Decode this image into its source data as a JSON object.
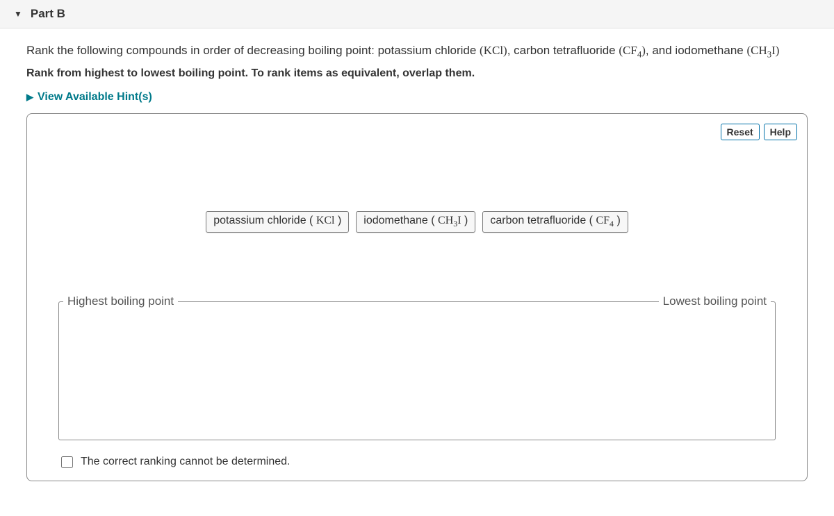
{
  "header": {
    "title": "Part B"
  },
  "prompt": {
    "intro": "Rank the following compounds in order of decreasing boiling point:  potassium chloride ",
    "c1_formula": "(KCl)",
    "mid1": ", carbon tetrafluoride ",
    "c2_formula_pre": "(CF",
    "c2_sub": "4",
    "c2_post": ")",
    "mid2": ", and iodomethane ",
    "c3_formula_pre": "(CH",
    "c3_sub": "3",
    "c3_post": "I)"
  },
  "instruction": "Rank from highest to lowest boiling point. To rank items as equivalent, overlap them.",
  "hints_label": "View Available Hint(s)",
  "buttons": {
    "reset": "Reset",
    "help": "Help"
  },
  "items": {
    "i1_name": "potassium chloride ( ",
    "i1_formula": "KCl",
    "i1_close": " )",
    "i2_name": "iodomethane ( ",
    "i2_formula_pre": "CH",
    "i2_sub": "3",
    "i2_formula_post": "I",
    "i2_close": " )",
    "i3_name": "carbon tetrafluoride ( ",
    "i3_formula_pre": "CF",
    "i3_sub": "4",
    "i3_close": " )"
  },
  "zone": {
    "left_label": "Highest boiling point",
    "right_label": "Lowest boiling point"
  },
  "checkbox_label": "The correct ranking cannot be determined."
}
